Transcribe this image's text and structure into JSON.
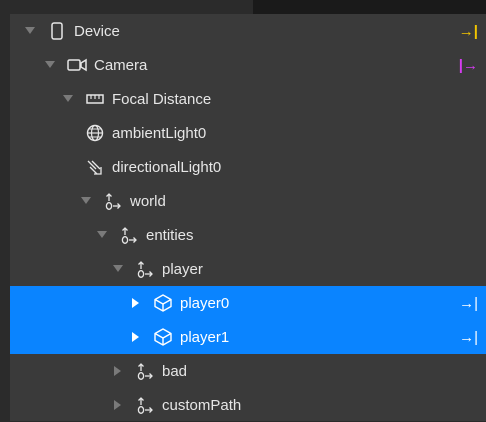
{
  "colors": {
    "panel": "#3a3a3a",
    "selection": "#0a84ff",
    "text": "#e6e6e6",
    "yellow": "#f2c500",
    "magenta": "#d63cf2"
  },
  "tree": {
    "items": [
      {
        "label": "Device",
        "icon": "device-icon",
        "expanded": true,
        "right_mark": "→|"
      },
      {
        "label": "Camera",
        "icon": "camera-icon",
        "expanded": true,
        "right_mark": "|→"
      },
      {
        "label": "Focal Distance",
        "icon": "ruler-icon",
        "expanded": true
      },
      {
        "label": "ambientLight0",
        "icon": "globe-icon"
      },
      {
        "label": "directionalLight0",
        "icon": "directional-light-icon"
      },
      {
        "label": "world",
        "icon": "null-object-icon",
        "expanded": true
      },
      {
        "label": "entities",
        "icon": "null-object-icon",
        "expanded": true
      },
      {
        "label": "player",
        "icon": "null-object-icon",
        "expanded": true
      },
      {
        "label": "player0",
        "icon": "cube-icon",
        "expanded": false,
        "selected": true,
        "right_mark": "→|"
      },
      {
        "label": "player1",
        "icon": "cube-icon",
        "expanded": false,
        "selected": true,
        "right_mark": "→|"
      },
      {
        "label": "bad",
        "icon": "null-object-icon",
        "expanded": false
      },
      {
        "label": "customPath",
        "icon": "null-object-icon",
        "expanded": false
      }
    ]
  }
}
